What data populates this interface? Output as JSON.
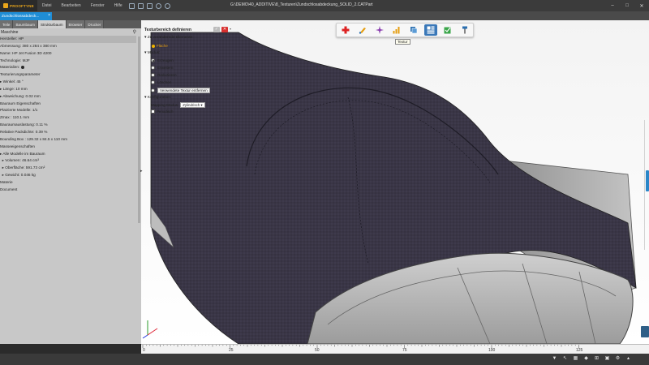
{
  "app": {
    "logo_text": "PROOFTYNE",
    "menu": [
      "Datei",
      "Bearbeiten",
      "Fenster",
      "Hilfe"
    ],
    "file_path": "G:\\DEMO\\40_ADDITIVE\\8_Texturen\\Zundschlosabdeckung_SOLID_2.CATPart"
  },
  "doc_tab": {
    "label": "Zundschlossabdeck...",
    "close": "×"
  },
  "left_panel": {
    "tabs": [
      "Teile",
      "Baumbaum",
      "Strukturbaum",
      "Browser",
      "Drucker"
    ],
    "active_tab": 2,
    "header": "Maschine",
    "properties": [
      {
        "label": "Hersteller: HP"
      },
      {
        "label": "Abmessung: 380 x 284 x 380 mm"
      },
      {
        "label": "Name: HP Jet Fusion 3D 4200"
      },
      {
        "label": "Technologie: MJF"
      },
      {
        "label": "Materialien:",
        "info": true
      },
      {
        "label": "Texturierungsparameter"
      },
      {
        "label": "Winkel: 45 °",
        "bullet": true
      },
      {
        "label": "Länge: 10 mm",
        "bullet": true
      },
      {
        "label": "Abweichung: 0.02 mm",
        "bullet": true
      },
      {
        "label": "Bauraum Eigenschaften"
      },
      {
        "label": "Platzierte Modelle: 1/1"
      },
      {
        "label": "Zmax : 110.1 mm"
      },
      {
        "label": "Bauraumauslastung: 0.11 %"
      },
      {
        "label": "Relative Packdichte: 0.39 %"
      },
      {
        "label": "Bounding Box : 129.32 x 84.5 x 110 mm"
      },
      {
        "label": "Masseeigenschaften"
      },
      {
        "label": "Alle Modelle im Bauraum",
        "bullet": true
      },
      {
        "label": "Volumen: 46.64 cm³",
        "bullet2": true
      },
      {
        "label": "Oberfläche: 591.73 cm²",
        "bullet2": true
      },
      {
        "label": "Gewicht: 0.046 kg",
        "bullet2": true
      },
      {
        "label": "Materie"
      },
      {
        "label": "Document"
      }
    ]
  },
  "dialog": {
    "title": "Texturbereich definieren",
    "section_elements": "Zu verändernde Elemente:",
    "element_chip": "Fläche",
    "section_mode": "Modus:",
    "modes": [
      "Erzeugen",
      "Erweitern",
      "Reduzieren",
      "Löschen",
      "Verwendete Textur entfernen"
    ],
    "selected_mode": 0,
    "remove_button": "Verwendete Textur entfernen",
    "section_config": "Konfiguration:",
    "mapping_label": "Mapping-Modus:",
    "mapping_value": "Zylindrisch",
    "periodic_label": "Periodisch"
  },
  "palette": {
    "tools": [
      "add-cross-icon",
      "paint-brush-icon",
      "star-spark-icon",
      "bar-chart-icon",
      "layers-icon",
      "texture-icon",
      "export-check-icon",
      "pin-icon"
    ],
    "active_index": 5,
    "tooltip": "Textur"
  },
  "ruler": {
    "labels": [
      "0",
      "25",
      "50",
      "75",
      "100",
      "125"
    ]
  },
  "colors": {
    "accent_blue": "#1f8dd6",
    "cancel_red": "#d8302f",
    "chip_orange": "#e59e10",
    "model_dark": "#3b3747"
  }
}
